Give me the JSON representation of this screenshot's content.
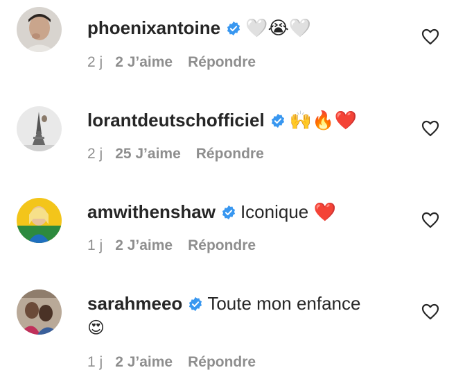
{
  "colors": {
    "text": "#262626",
    "secondary": "#8e8e8e",
    "verified": "#3897f0",
    "heart_outline": "#262626"
  },
  "comments": [
    {
      "username": "phoenixantoine",
      "verified_icon": "verified-badge-icon",
      "text": "🤍😭🤍",
      "time": "2 j",
      "likes": "2 J’aime",
      "reply": "Répondre"
    },
    {
      "username": "lorantdeutschofficiel",
      "verified_icon": "verified-badge-icon",
      "text": "🙌🔥❤️",
      "time": "2 j",
      "likes": "25 J’aime",
      "reply": "Répondre"
    },
    {
      "username": "amwithenshaw",
      "verified_icon": "verified-badge-icon",
      "text": "Iconique ❤️",
      "time": "1 j",
      "likes": "2 J’aime",
      "reply": "Répondre"
    },
    {
      "username": "sarahmeeo",
      "verified_icon": "verified-badge-icon",
      "text": "Toute mon enfance",
      "emoji_line": "😍",
      "time": "1 j",
      "likes": "2 J’aime",
      "reply": "Répondre"
    }
  ]
}
